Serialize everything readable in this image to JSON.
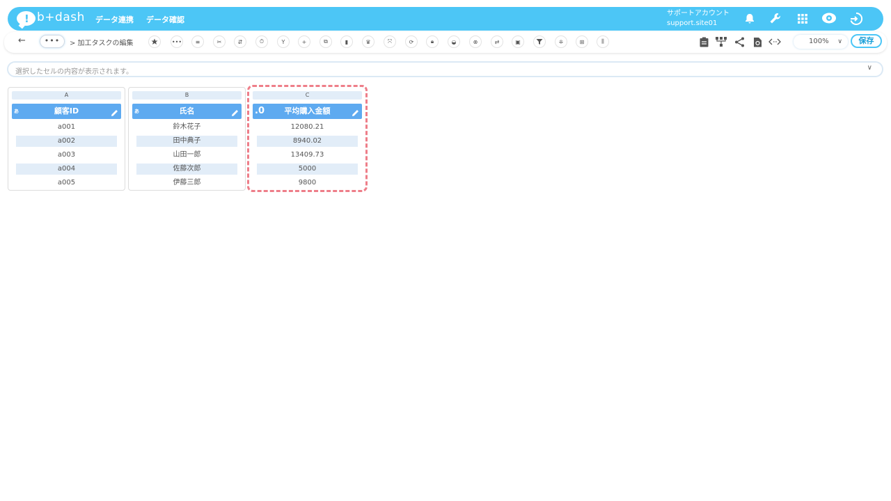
{
  "header": {
    "logo_text": "b+dash",
    "nav": [
      "データ連携",
      "データ確認"
    ],
    "account_label": "サポートアカウント",
    "account_site": "support.site01"
  },
  "toolbar": {
    "back": "←",
    "more": "•••",
    "breadcrumb": "> 加工タスクの編集",
    "zoom": "100%",
    "save": "保存"
  },
  "formula": {
    "placeholder": "選択したセルの内容が表示されます。"
  },
  "columns": [
    {
      "letter": "A",
      "type": "あ",
      "name": "顧客ID",
      "values": [
        "a001",
        "a002",
        "a003",
        "a004",
        "a005"
      ]
    },
    {
      "letter": "B",
      "type": "あ",
      "name": "氏名",
      "values": [
        "鈴木花子",
        "田中典子",
        "山田一郎",
        "佐藤次郎",
        "伊藤三郎"
      ]
    },
    {
      "letter": "C",
      "type": ".0",
      "name": "平均購入金額",
      "values": [
        "12080.21",
        "8940.02",
        "13409.73",
        "5000",
        "9800"
      ]
    }
  ],
  "colors": {
    "header": "#4cc6f6",
    "column_header": "#5eaaf0",
    "alt_row": "#e2edf8",
    "selection": "#ee7e89"
  }
}
